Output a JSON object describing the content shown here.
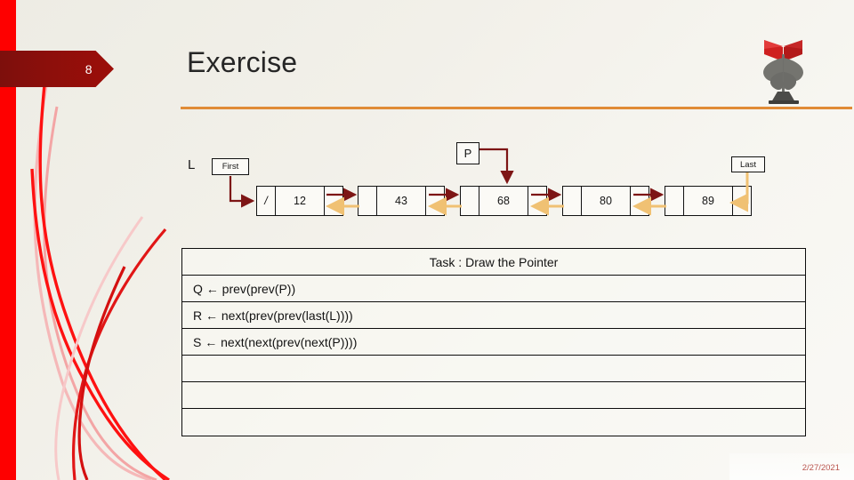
{
  "slide": {
    "number": "8",
    "title": "Exercise",
    "footer_date": "2/27/2021",
    "accent_orange": "#e08b36",
    "accent_red": "#fe0000",
    "banner_dark_red": "#8d0f0b",
    "arrow_next_color": "#7d1515",
    "arrow_prev_color": "#f0c173",
    "background": "#f2f0e9"
  },
  "emblem": {
    "name": "university-emblem",
    "book_color": "#d62424",
    "figure_color": "#70706c"
  },
  "diagram": {
    "list_label": "L",
    "first_box": "First",
    "last_box": "Last",
    "p_box": "P",
    "nil_glyph": "/",
    "nodes": [
      {
        "prev": "/",
        "value": "12",
        "next": ""
      },
      {
        "prev": "",
        "value": "43",
        "next": ""
      },
      {
        "prev": "",
        "value": "68",
        "next": ""
      },
      {
        "prev": "",
        "value": "80",
        "next": ""
      },
      {
        "prev": "",
        "value": "89",
        "next": "/"
      }
    ],
    "p_points_to": "68",
    "first_points_to": "12",
    "last_points_to": "89"
  },
  "task_table": {
    "header": "Task : Draw the Pointer",
    "entries": [
      "Q ← prev(prev(P))",
      "R ← next(prev(prev(last(L))))",
      "S ← next(next(prev(next(P))))"
    ],
    "empty_rows": 3
  }
}
